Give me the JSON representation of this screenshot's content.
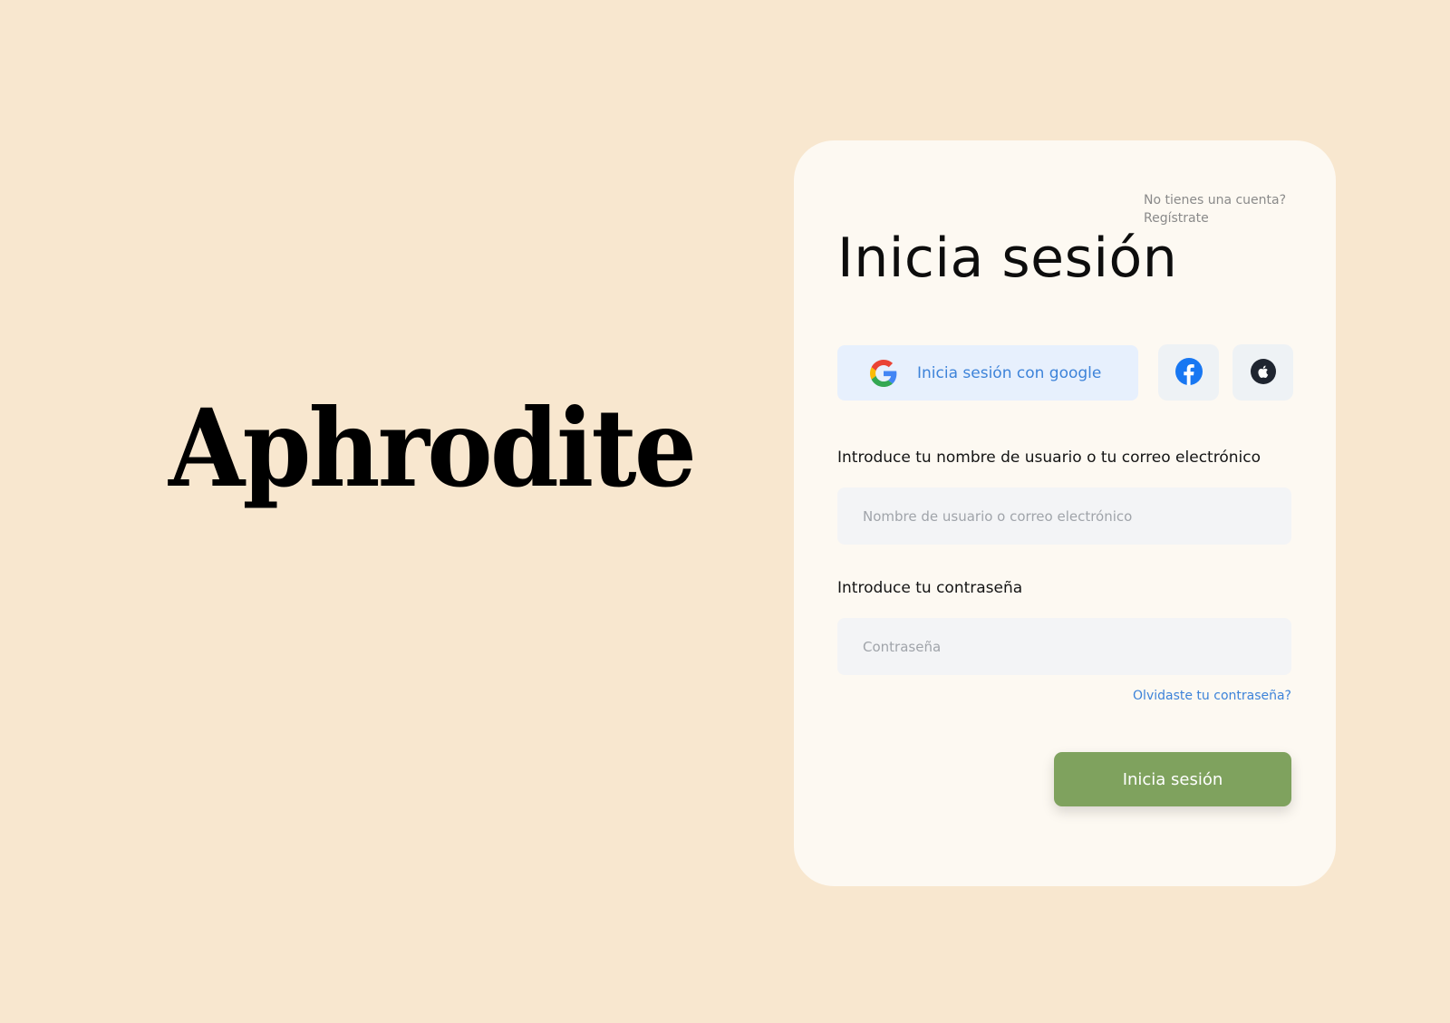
{
  "brand": {
    "name": "Aphrodite"
  },
  "login_card": {
    "signup_prompt": "No tienes una cuenta?",
    "signup_link": "Regístrate",
    "title": "Inicia sesión",
    "google_button_label": "Inicia sesión con google",
    "facebook_icon": "facebook-icon",
    "apple_icon": "apple-icon",
    "username_label": "Introduce tu nombre de usuario o tu correo electrónico",
    "username_placeholder": "Nombre de usuario o correo electrónico",
    "username_value": "",
    "password_label": "Introduce tu contraseña",
    "password_placeholder": "Contraseña",
    "password_value": "",
    "forgot_password": "Olvidaste tu contraseña?",
    "submit_label": "Inicia sesión"
  },
  "colors": {
    "background": "#f8e7cf",
    "card": "#fdf9f2",
    "accent_blue": "#3d83d9",
    "google_button_bg": "#e7f0fd",
    "submit_green": "#7fa25e",
    "facebook_blue": "#1877f2"
  }
}
